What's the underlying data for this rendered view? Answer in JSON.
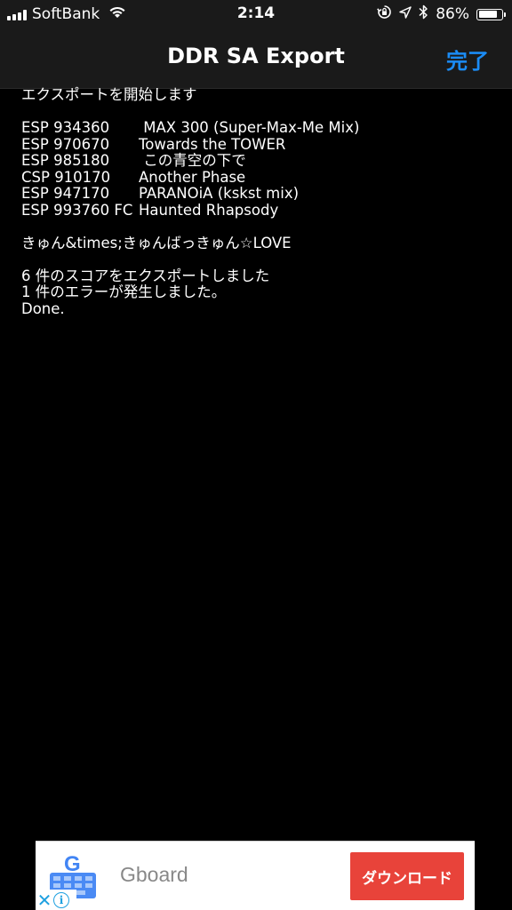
{
  "status_bar": {
    "carrier": "SoftBank",
    "time": "2:14",
    "battery_percent": "86%",
    "battery_level": 0.86,
    "icons": [
      "signal-icon",
      "wifi-icon",
      "orientation-lock-icon",
      "location-icon",
      "bluetooth-icon",
      "battery-icon"
    ]
  },
  "nav": {
    "title": "DDR SA Export",
    "done_label": "完了"
  },
  "log": {
    "start": "エクスポートを開始します",
    "scores": [
      {
        "id": "ESP 934360",
        "song": " MAX 300 (Super-Max-Me Mix)"
      },
      {
        "id": "ESP 970670",
        "song": "Towards the TOWER"
      },
      {
        "id": "ESP 985180",
        "song": " この青空の下で"
      },
      {
        "id": "CSP 910170",
        "song": "Another Phase"
      },
      {
        "id": "ESP 947170",
        "song": "PARANOiA (kskst mix)"
      },
      {
        "id": "ESP 993760 FC",
        "song": "Haunted Rhapsody"
      }
    ],
    "error_song": "きゅん&times;きゅんばっきゅん☆LOVE",
    "summary_exported": "6 件のスコアをエクスポートしました",
    "summary_errors": "1 件のエラーが発生しました。",
    "done": "Done."
  },
  "ad": {
    "app_name": "Gboard",
    "icon_letter": "G",
    "cta_label": "ダウンロード",
    "close_glyph": "✕",
    "info_glyph": "i",
    "colors": {
      "cta_bg": "#e8433a",
      "icon_blue": "#4285f4",
      "adchoices_blue": "#1ea0e0"
    }
  },
  "colors": {
    "accent": "#1b8cf5",
    "background": "#000000",
    "bar_background": "#1a1a1a",
    "text": "#ffffff"
  }
}
